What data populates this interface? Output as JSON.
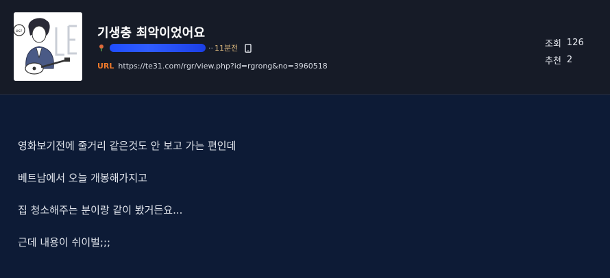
{
  "post": {
    "title": "기생충 최악이었어요",
    "time": "11분전",
    "url_label": "URL",
    "url": "https://te31.com/rgr/view.php?id=rgrong&no=3960518",
    "author_dots": "··"
  },
  "stats": {
    "views_label": "조회",
    "views": "126",
    "recommend_label": "추천",
    "recommend": "2"
  },
  "body": {
    "lines": [
      "영화보기전에 줄거리 같은것도 안 보고 가는 편인데",
      "베트남에서 오늘 개봉해가지고",
      "집 청소해주는 분이랑 같이 봤거든요...",
      "근데 내용이 쉬이벌;;;"
    ]
  },
  "colors": {
    "header_bg": "#161b27",
    "page_bg": "#0d1b36",
    "url_label": "#f07a2a",
    "time": "#d4b27a"
  },
  "icons": [
    "avatar-image",
    "flower-icon",
    "redaction-mark",
    "mobile-phone-icon"
  ]
}
